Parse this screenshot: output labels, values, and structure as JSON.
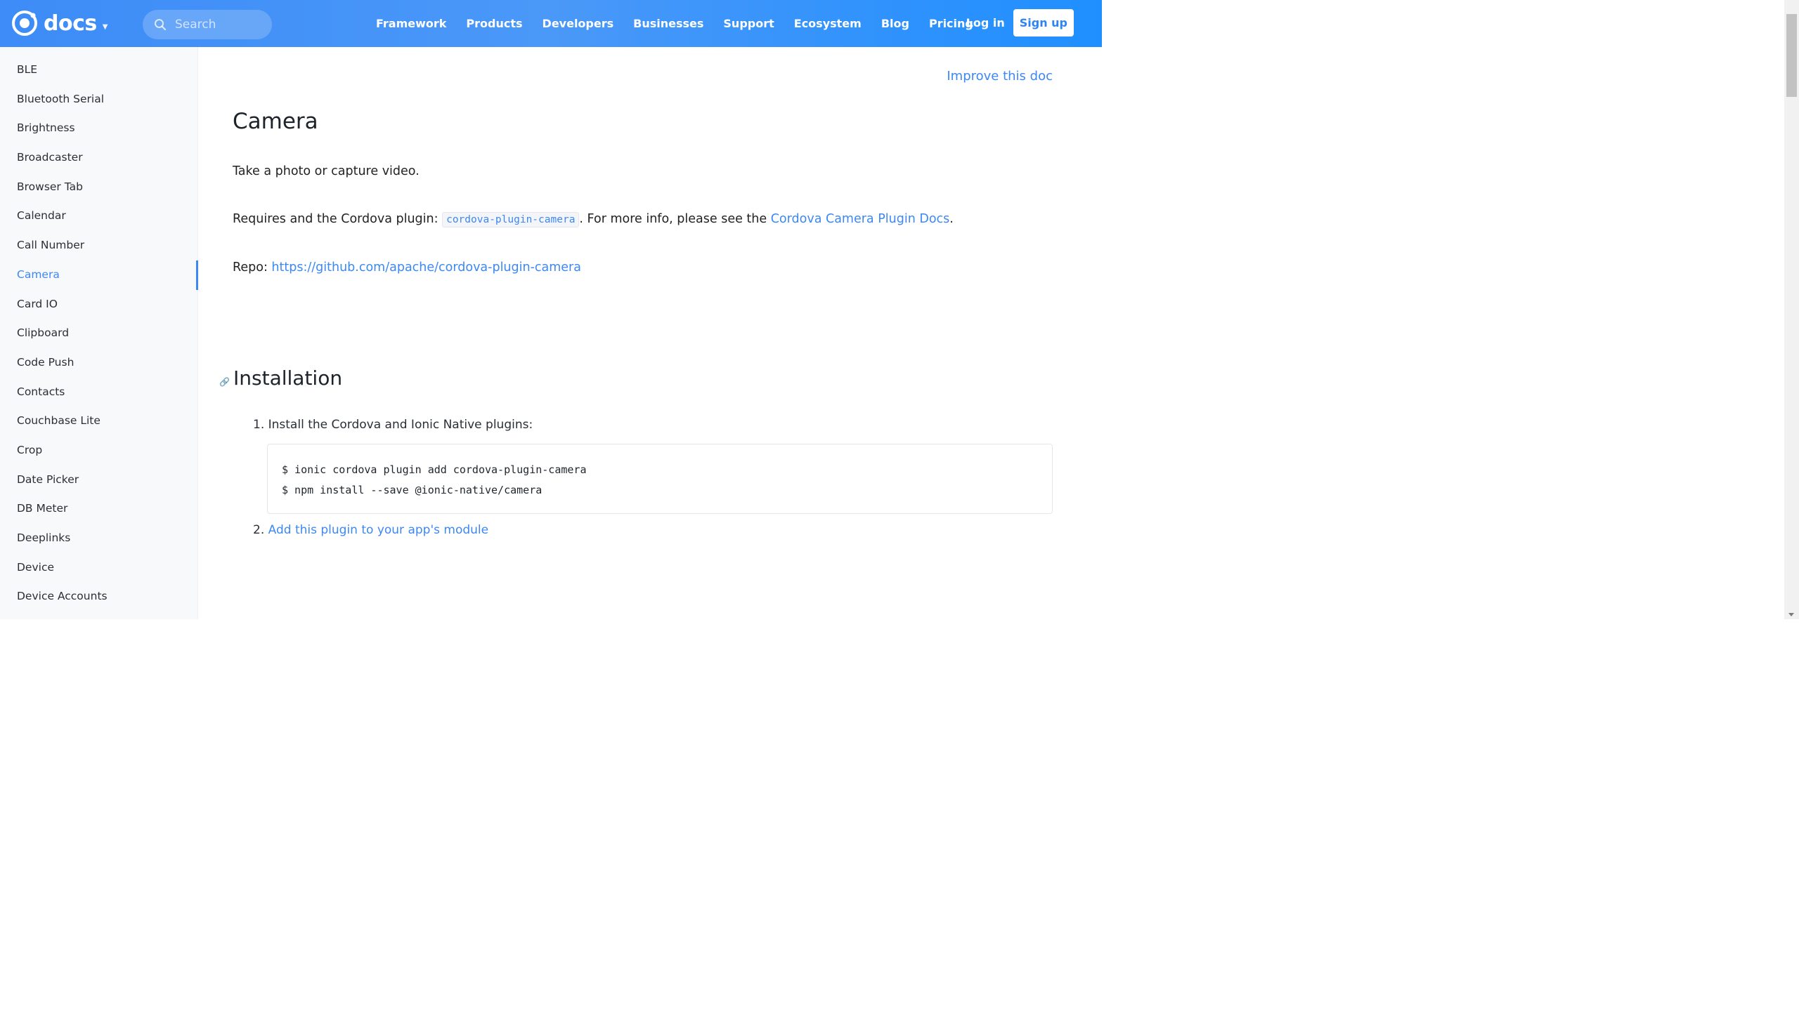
{
  "header": {
    "logo_text": "docs",
    "search_placeholder": "Search",
    "nav": [
      "Framework",
      "Products",
      "Developers",
      "Businesses",
      "Support",
      "Ecosystem",
      "Blog",
      "Pricing"
    ],
    "login": "Log in",
    "signup": "Sign up"
  },
  "sidebar": {
    "items": [
      "BLE",
      "Bluetooth Serial",
      "Brightness",
      "Broadcaster",
      "Browser Tab",
      "Calendar",
      "Call Number",
      "Camera",
      "Card IO",
      "Clipboard",
      "Code Push",
      "Contacts",
      "Couchbase Lite",
      "Crop",
      "Date Picker",
      "DB Meter",
      "Deeplinks",
      "Device",
      "Device Accounts"
    ],
    "active": "Camera"
  },
  "content": {
    "improve_link": "Improve this doc",
    "title": "Camera",
    "description": "Take a photo or capture video.",
    "requires_prefix": "Requires and the Cordova plugin: ",
    "plugin_code": "cordova-plugin-camera",
    "requires_middle": ". For more info, please see the ",
    "docs_link": "Cordova Camera Plugin Docs",
    "requires_suffix": ".",
    "repo_label": "Repo: ",
    "repo_link": "https://github.com/apache/cordova-plugin-camera",
    "installation_heading": "Installation",
    "step1": "1. Install the Cordova and Ionic Native plugins:",
    "code_line1": "$ ionic cordova plugin add cordova-plugin-camera",
    "code_line2": "$ npm install --save @ionic-native/camera",
    "step2_num": "2. ",
    "step2_link": "Add this plugin to your app's module"
  }
}
